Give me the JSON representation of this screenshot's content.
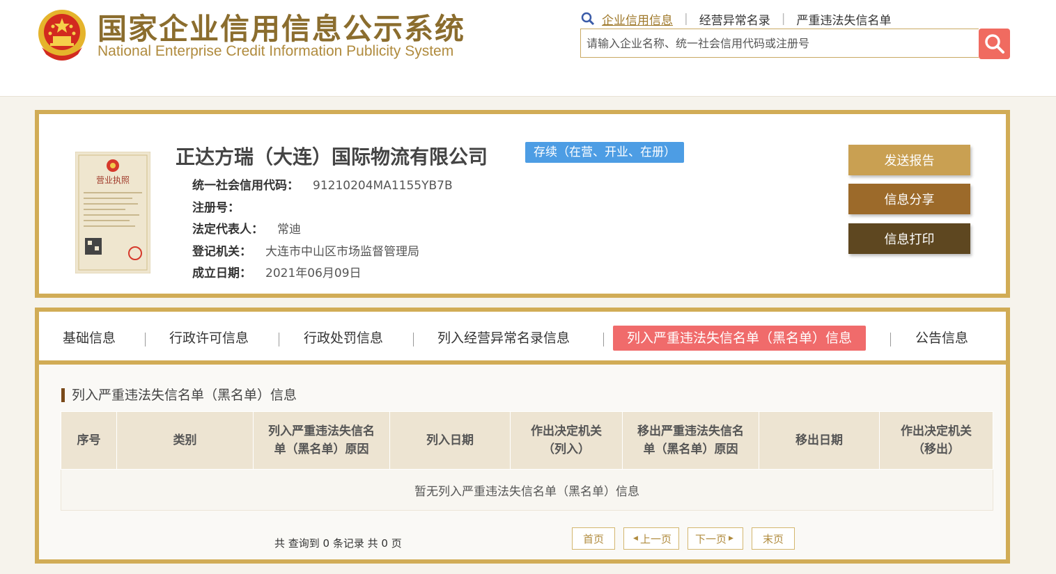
{
  "header": {
    "title": "国家企业信用信息公示系统",
    "subtitle": "National Enterprise Credit Information Publicity System",
    "nav": [
      {
        "label": "企业信用信息",
        "active": true
      },
      {
        "label": "经营异常名录",
        "active": false
      },
      {
        "label": "严重违法失信名单",
        "active": false
      }
    ],
    "search": {
      "placeholder": "请输入企业名称、统一社会信用代码或注册号",
      "value": ""
    }
  },
  "company": {
    "name": "正达方瑞（大连）国际物流有限公司",
    "status": "存续（在营、开业、在册）",
    "fields": [
      {
        "label": "统一社会信用代码：",
        "value": "91210204MA1155YB7B"
      },
      {
        "label": "注册号：",
        "value": ""
      },
      {
        "label": "法定代表人：",
        "value": "常迪"
      },
      {
        "label": "登记机关：",
        "value": "大连市中山区市场监督管理局"
      },
      {
        "label": "成立日期：",
        "value": "2021年06月09日"
      }
    ],
    "license_title": "营业执照",
    "actions": {
      "send": "发送报告",
      "share": "信息分享",
      "print": "信息打印"
    }
  },
  "tabs": [
    {
      "label": "基础信息",
      "active": false
    },
    {
      "label": "行政许可信息",
      "active": false
    },
    {
      "label": "行政处罚信息",
      "active": false
    },
    {
      "label": "列入经营异常名录信息",
      "active": false
    },
    {
      "label": "列入严重违法失信名单（黑名单）信息",
      "active": true
    },
    {
      "label": "公告信息",
      "active": false
    }
  ],
  "section": {
    "title": "列入严重违法失信名单（黑名单）信息",
    "columns": [
      [
        "序号"
      ],
      [
        "类别"
      ],
      [
        "列入严重违法失信名",
        "单（黑名单）原因"
      ],
      [
        "列入日期"
      ],
      [
        "作出决定机关",
        "（列入）"
      ],
      [
        "移出严重违法失信名",
        "单（黑名单）原因"
      ],
      [
        "移出日期"
      ],
      [
        "作出决定机关",
        "（移出）"
      ]
    ],
    "empty_message": "暂无列入严重违法失信名单（黑名单）信息"
  },
  "pagination": {
    "summary": "共 查询到 0 条记录 共 0 页",
    "first": "首页",
    "prev": "上一页",
    "next": "下一页",
    "last": "末页"
  },
  "colors": {
    "gold": "#d1ac56",
    "brand_text": "#8b6d2e",
    "badge_blue": "#4d9de4",
    "active_tab": "#f06b6b",
    "btn_send": "#c9a052",
    "btn_share": "#9c6a2a",
    "btn_print": "#5e4720"
  },
  "icons": {
    "search": "magnifier-icon",
    "emblem": "national-emblem-icon",
    "license": "business-license-image"
  }
}
